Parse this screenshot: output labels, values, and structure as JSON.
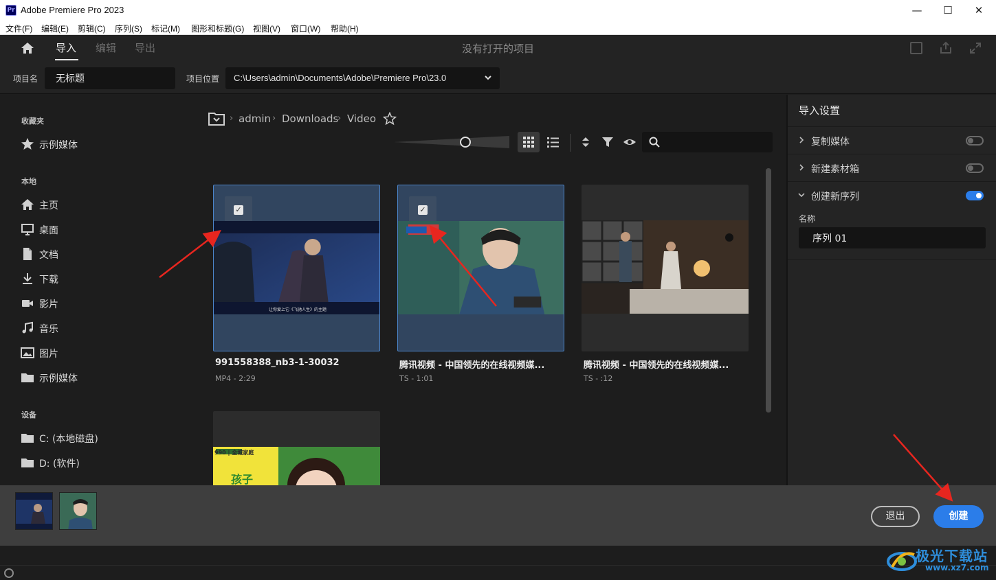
{
  "window": {
    "title": "Adobe Premiere Pro 2023",
    "logo": "Pr",
    "controls": {
      "minimize": "—",
      "maximize": "☐",
      "close": "✕"
    }
  },
  "menubar": {
    "items": [
      "文件(F)",
      "编辑(E)",
      "剪辑(C)",
      "序列(S)",
      "标记(M)",
      "图形和标题(G)",
      "视图(V)",
      "窗口(W)",
      "帮助(H)"
    ]
  },
  "header": {
    "tabs": [
      {
        "label": "导入",
        "active": true
      },
      {
        "label": "编辑",
        "active": false
      },
      {
        "label": "导出",
        "active": false
      }
    ],
    "title": "没有打开的项目",
    "icons": [
      "quick-export-icon",
      "share-icon",
      "fullscreen-icon"
    ]
  },
  "project": {
    "name_label": "项目名",
    "name_value": "无标题",
    "location_label": "项目位置",
    "location_value": "C:\\Users\\admin\\Documents\\Adobe\\Premiere Pro\\23.0"
  },
  "sidebar": {
    "favorites_heading": "收藏夹",
    "favorites": [
      {
        "label": "示例媒体",
        "icon": "star-icon"
      }
    ],
    "local_heading": "本地",
    "local": [
      {
        "label": "主页",
        "icon": "home-icon"
      },
      {
        "label": "桌面",
        "icon": "monitor-icon"
      },
      {
        "label": "文档",
        "icon": "document-icon"
      },
      {
        "label": "下载",
        "icon": "download-icon"
      },
      {
        "label": "影片",
        "icon": "video-camera-icon"
      },
      {
        "label": "音乐",
        "icon": "music-note-icon"
      },
      {
        "label": "图片",
        "icon": "image-icon"
      },
      {
        "label": "示例媒体",
        "icon": "folder-icon"
      }
    ],
    "devices_heading": "设备",
    "devices": [
      {
        "label": "C: (本地磁盘)",
        "icon": "folder-icon"
      },
      {
        "label": "D: (软件)",
        "icon": "folder-icon"
      }
    ]
  },
  "breadcrumb": {
    "parts": [
      "admin",
      "Downloads",
      "Video"
    ],
    "separator": "›"
  },
  "media": {
    "clips": [
      {
        "name": "991558388_nb3-1-30032",
        "meta": "MP4 - 2:29",
        "selected": true
      },
      {
        "name": "腾讯视频 - 中国领先的在线视频媒...",
        "meta": "TS - 1:01",
        "selected": true
      },
      {
        "name": "腾讯视频 - 中国领先的在线视频媒...",
        "meta": "TS - :12",
        "selected": false
      },
      {
        "name": "",
        "meta": "",
        "selected": false
      }
    ],
    "thumb_texts": [
      "让你爱上它《飞驰人生》的主题",
      "990 | 全城家庭",
      "孩子"
    ]
  },
  "settings": {
    "title": "导入设置",
    "rows": [
      {
        "label": "复制媒体",
        "expanded": false,
        "on": false
      },
      {
        "label": "新建素材箱",
        "expanded": false,
        "on": false
      },
      {
        "label": "创建新序列",
        "expanded": true,
        "on": true
      }
    ],
    "sequence_name_label": "名称",
    "sequence_name_value": "序列 01"
  },
  "footer": {
    "exit_label": "退出",
    "create_label": "创建"
  },
  "watermark": {
    "text": "极光下载站",
    "url": "www.xz7.com"
  },
  "colors": {
    "accent": "#2b7de9",
    "selected_card": "#31455f",
    "arrow": "#e8261f"
  }
}
